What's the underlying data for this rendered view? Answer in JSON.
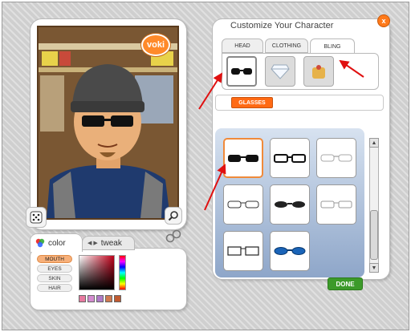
{
  "logo": {
    "text": "voki"
  },
  "customize": {
    "title": "Customize Your Character",
    "close_label": "x",
    "tabs": [
      {
        "label": "HEAD",
        "active": false
      },
      {
        "label": "CLOTHING",
        "active": false
      },
      {
        "label": "BLING",
        "active": true
      }
    ],
    "categories": [
      {
        "icon": "sunglasses-icon",
        "active": true
      },
      {
        "icon": "diamond-icon",
        "active": false
      },
      {
        "icon": "accessories-icon",
        "active": false
      }
    ],
    "subcategory": "GLASSES",
    "items": [
      {
        "icon": "dark-sunglasses-icon",
        "selected": true
      },
      {
        "icon": "black-frame-glasses-icon",
        "selected": false
      },
      {
        "icon": "rimless-glasses-icon",
        "selected": false
      },
      {
        "icon": "thin-frame-glasses-icon",
        "selected": false
      },
      {
        "icon": "black-shades-icon",
        "selected": false
      },
      {
        "icon": "light-frame-glasses-icon",
        "selected": false
      },
      {
        "icon": "rectangle-glasses-icon",
        "selected": false
      },
      {
        "icon": "blue-shades-icon",
        "selected": false
      }
    ],
    "done_label": "DONE"
  },
  "color_panel": {
    "color_tab": "color",
    "tweak_tab": "tweak",
    "parts": [
      "MOUTH",
      "EYES",
      "SKIN",
      "HAIR"
    ],
    "active_part": "MOUTH",
    "swatches": [
      "#e87aa0",
      "#d48bd0",
      "#b07ac8",
      "#d07a50",
      "#c05a30"
    ]
  },
  "colors": {
    "accent": "#ff6a14",
    "done": "#3c9a2a",
    "arrow": "#e01010"
  }
}
